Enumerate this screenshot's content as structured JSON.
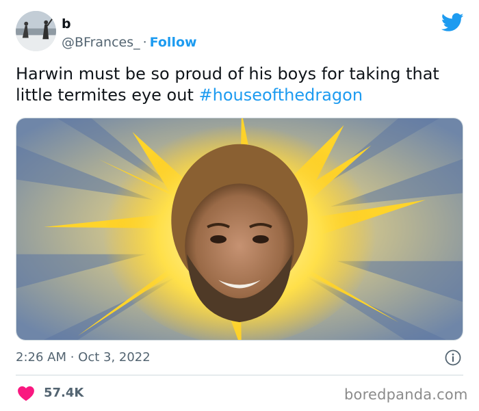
{
  "author": {
    "name": "b",
    "handle": "@BFrances_",
    "separator": "·",
    "follow_label": "Follow"
  },
  "tweet": {
    "text": "Harwin must be so proud of his boys for taking that little termites eye out",
    "hashtag": "#houseofthedragon"
  },
  "meta": {
    "timestamp": "2:26 AM · Oct 3, 2022"
  },
  "stats": {
    "likes": "57.4K"
  },
  "watermark": "boredpanda.com",
  "icons": {
    "logo": "twitter-bird-icon",
    "info": "info-icon",
    "like": "heart-icon"
  },
  "colors": {
    "accent": "#1d9bf0",
    "like": "#f91880",
    "muted": "#536471",
    "text": "#0f1419"
  }
}
